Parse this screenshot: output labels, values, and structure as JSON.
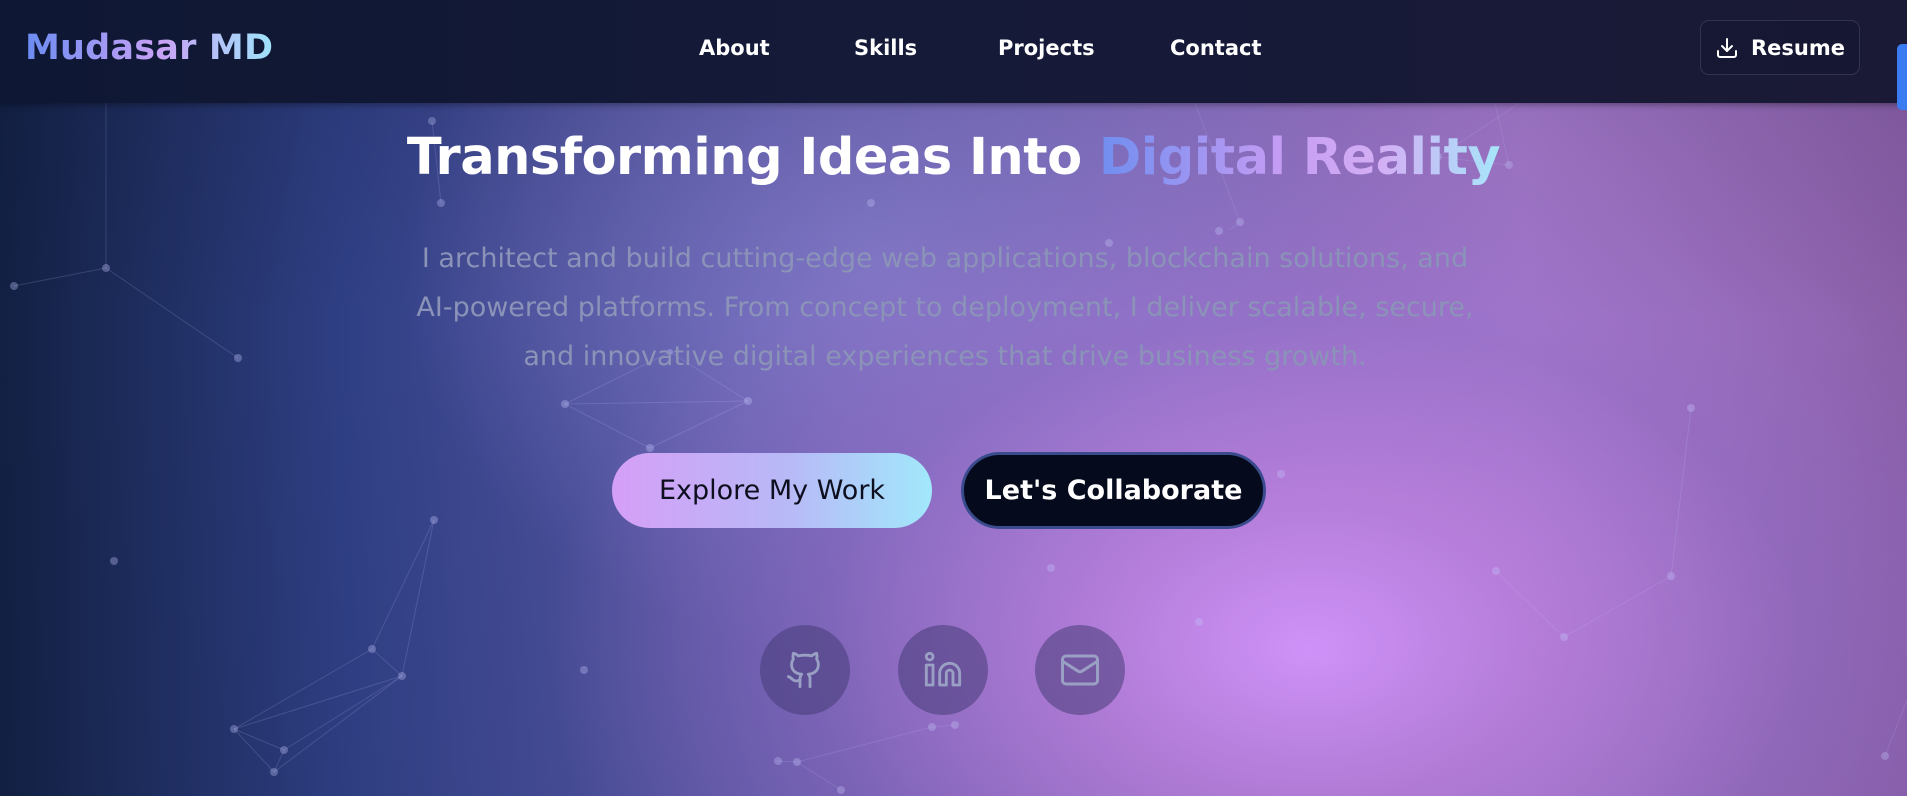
{
  "nav": {
    "logo": "Mudasar MD",
    "links": [
      {
        "label": "About"
      },
      {
        "label": "Skills"
      },
      {
        "label": "Projects"
      },
      {
        "label": "Contact"
      }
    ],
    "resume_label": "Resume",
    "resume_icon": "download-icon"
  },
  "hero": {
    "headline_plain": "Transforming Ideas Into ",
    "headline_highlight": "Digital Reality",
    "description": "I architect and build cutting-edge web applications, blockchain solutions, and AI-powered platforms. From concept to deployment, I deliver scalable, secure, and innovative digital experiences that drive business growth.",
    "primary_button": "Explore My Work",
    "secondary_button": "Let's Collaborate",
    "social": [
      {
        "icon": "github-icon"
      },
      {
        "icon": "linkedin-icon"
      },
      {
        "icon": "mail-icon"
      }
    ]
  },
  "colors": {
    "accent_gradient_start": "#d59ff7",
    "accent_gradient_end": "#a1e8fb",
    "nav_background": "#111833",
    "scrollbar": "#3a7bf2"
  }
}
